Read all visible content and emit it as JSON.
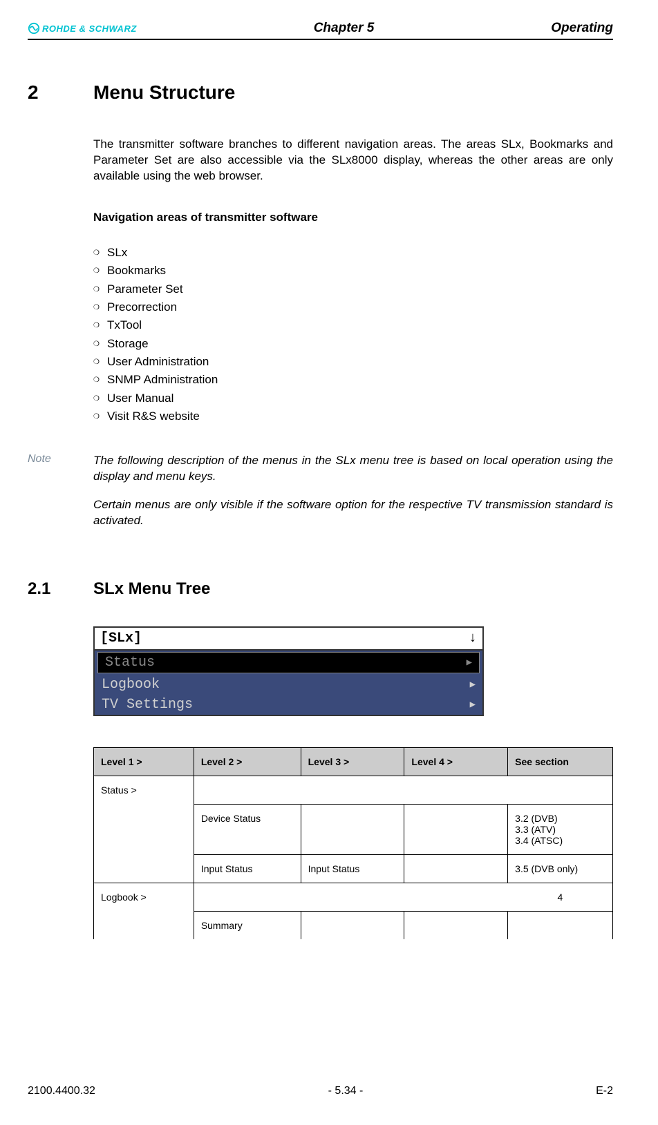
{
  "header": {
    "brand": "ROHDE & SCHWARZ",
    "chapter": "Chapter 5",
    "right": "Operating"
  },
  "section": {
    "number": "2",
    "title": "Menu Structure",
    "intro": "The transmitter software branches to different navigation areas. The areas SLx, Bookmarks and Parameter Set are also accessible via the SLx8000 display, whereas the other areas are only available using the web browser."
  },
  "nav": {
    "heading": "Navigation areas of transmitter software",
    "items": [
      "SLx",
      "Bookmarks",
      "Parameter Set",
      "Precorrection",
      "TxTool",
      "Storage",
      "User Administration",
      "SNMP Administration",
      "User Manual",
      "Visit R&S website"
    ]
  },
  "note": {
    "label": "Note",
    "p1": "The following description of the menus in the SLx menu tree is based on local operation using the display and menu keys.",
    "p2": "Certain menus are only visible if the software option for the respective TV transmission standard is activated."
  },
  "subsection": {
    "number": "2.1",
    "title": "SLx Menu Tree"
  },
  "device": {
    "title": "[SLx]",
    "rows": [
      "Status",
      "Logbook",
      "TV Settings"
    ]
  },
  "table": {
    "headers": [
      "Level 1 >",
      "Level 2 >",
      "Level 3 >",
      "Level 4 >",
      "See section"
    ],
    "r1c1": "Status >",
    "r2c2": "Device Status",
    "r2c5a": "3.2 (DVB)",
    "r2c5b": "3.3 (ATV)",
    "r2c5c": "3.4 (ATSC)",
    "r3c2": "Input Status",
    "r3c3": "Input Status",
    "r3c5": "3.5 (DVB only)",
    "r4c1": "Logbook >",
    "r4c5": "4",
    "r5c2": "Summary"
  },
  "footer": {
    "left": "2100.4400.32",
    "center": "- 5.34 -",
    "right": "E-2"
  }
}
